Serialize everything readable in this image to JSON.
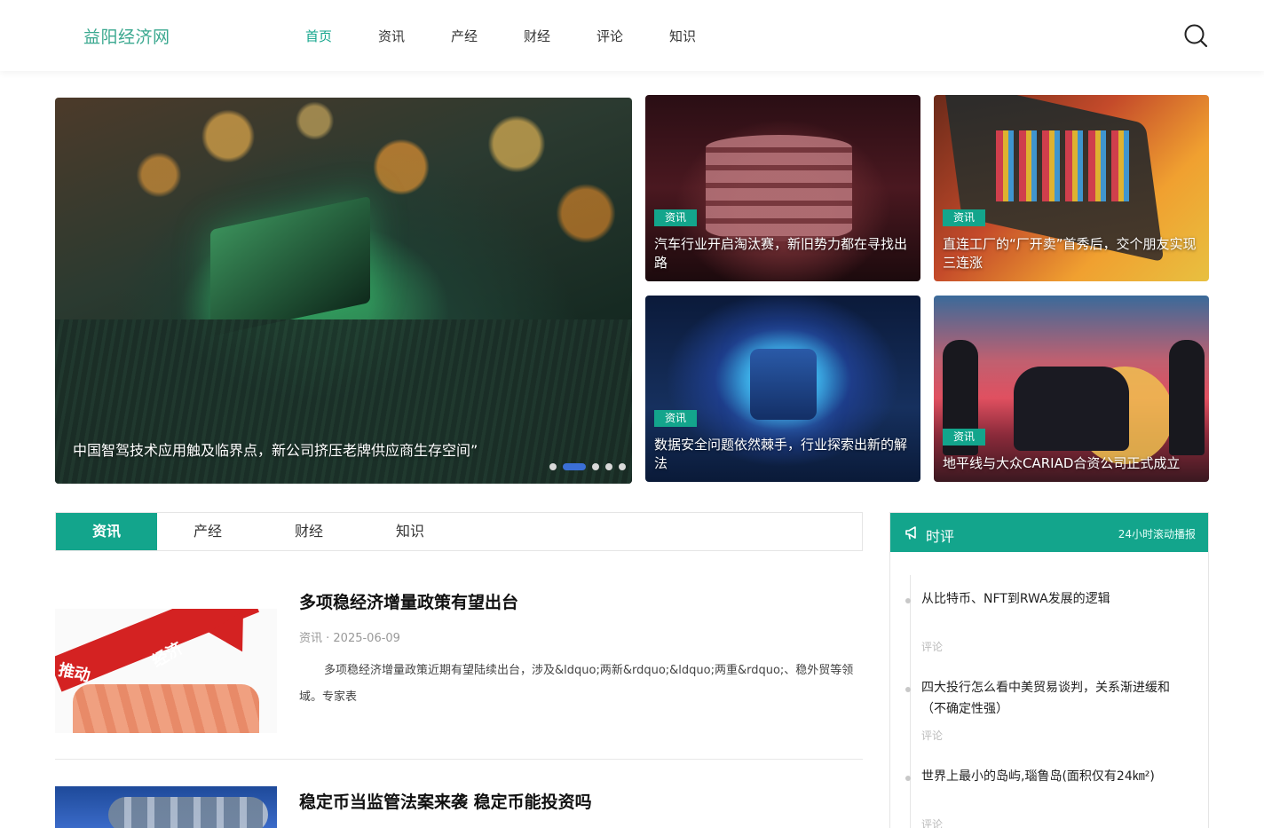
{
  "header": {
    "logo": "益阳经济网",
    "nav": [
      "首页",
      "资讯",
      "产经",
      "财经",
      "评论",
      "知识"
    ]
  },
  "hero": {
    "title": "中国智驾技术应用触及临界点，新公司挤压老牌供应商生存空间”",
    "slide_count": 5,
    "active_slide": 2
  },
  "cards": [
    {
      "tag": "资讯",
      "title": "汽车行业开启淘汰赛，新旧势力都在寻找出路"
    },
    {
      "tag": "资讯",
      "title": "直连工厂的“厂开卖”首秀后，交个朋友实现三连涨"
    },
    {
      "tag": "资讯",
      "title": "数据安全问题依然棘手，行业探索出新的解法"
    },
    {
      "tag": "资讯",
      "title": "地平线与大众CARIAD合资公司正式成立"
    }
  ],
  "tabs": [
    "资讯",
    "产经",
    "财经",
    "知识"
  ],
  "articles": [
    {
      "title": "多项稳经济增量政策有望出台",
      "meta": "资讯 · 2025-06-09",
      "desc": "多项稳经济增量政策近期有望陆续出台，涉及&ldquo;两新&rdquo;&ldquo;两重&rdquo;、稳外贸等领域。专家表",
      "thumb_text": [
        "推动",
        "经济"
      ]
    },
    {
      "title": "稳定币当监管法案来袭 稳定币能投资吗"
    }
  ],
  "sidebar": {
    "title": "时评",
    "subtitle": "24小时滚动播报",
    "items": [
      {
        "text": "从比特币、NFT到RWA发展的逻辑",
        "tag": "评论"
      },
      {
        "text": "四大投行怎么看中美贸易谈判，关系渐进缓和（不确定性强）",
        "tag": "评论"
      },
      {
        "text": "世界上最小的岛屿,瑙鲁岛(面积仅有24㎞²)",
        "tag": "评论"
      }
    ]
  },
  "colors": {
    "accent": "#13a58c",
    "logo": "#3aa88f",
    "dot_active": "#3b6fd6"
  }
}
